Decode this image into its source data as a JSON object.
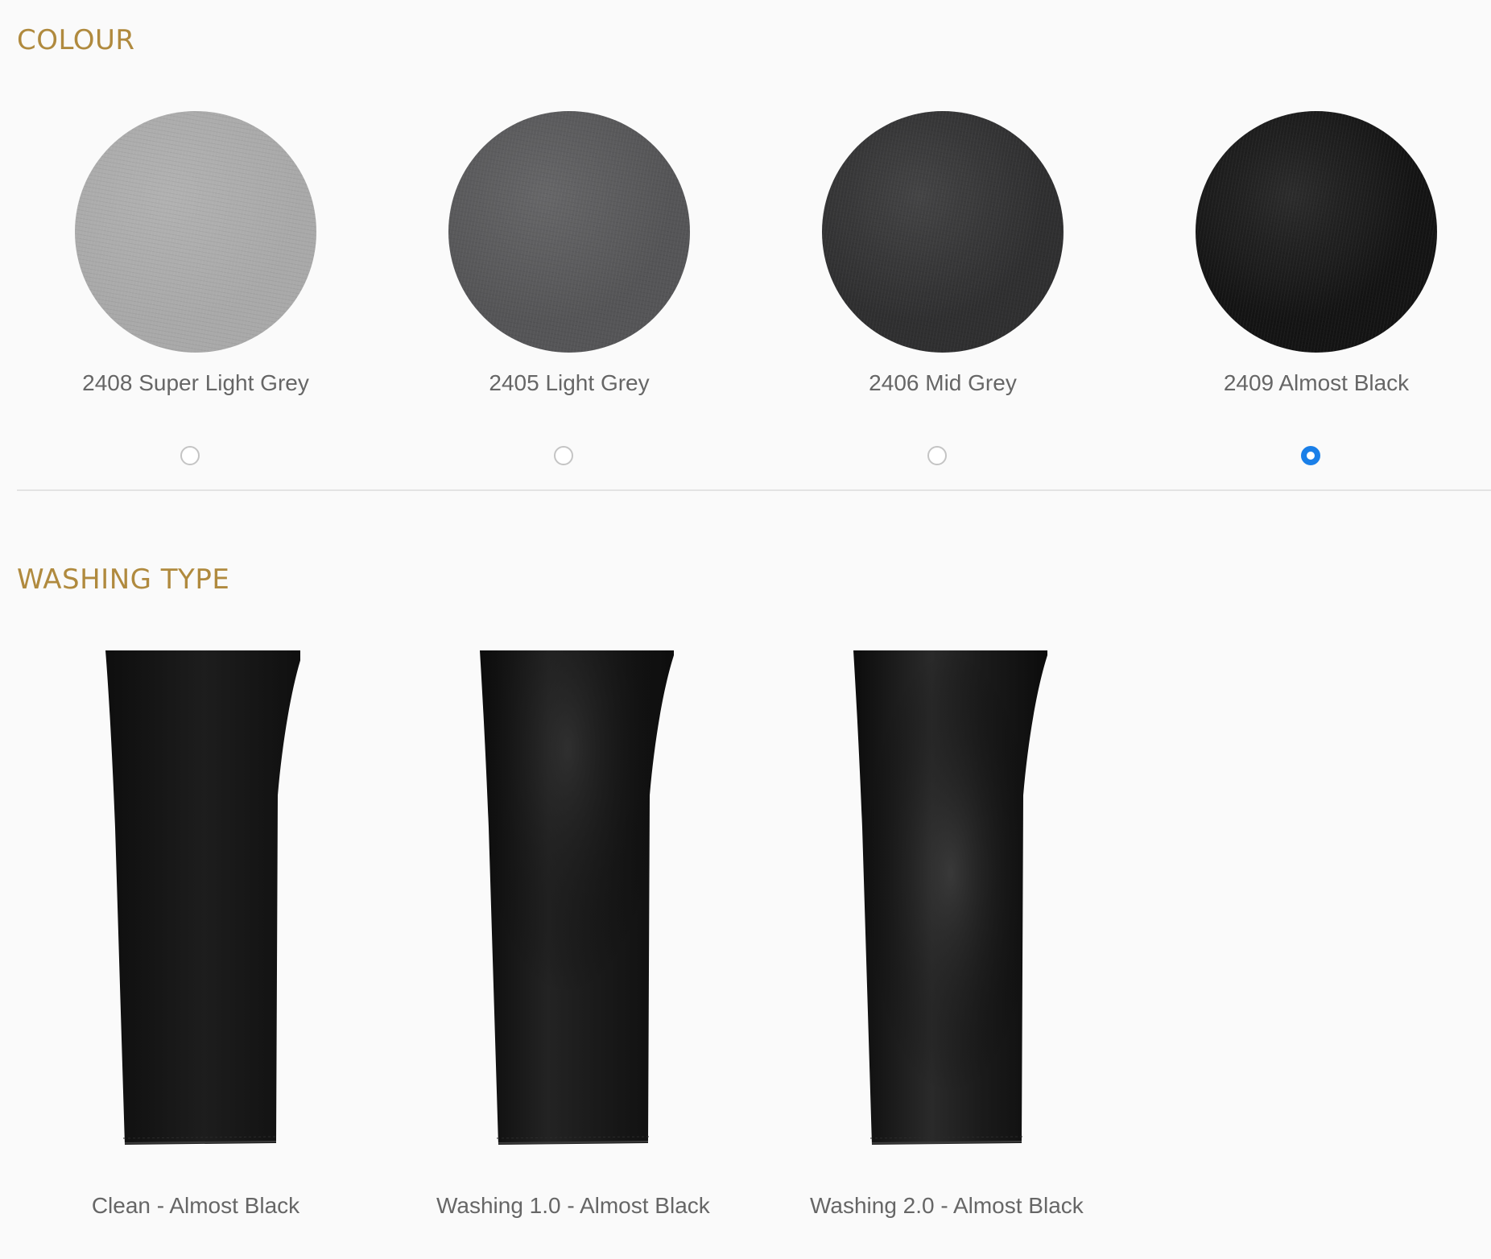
{
  "colour": {
    "title": "COLOUR",
    "selected_index": 3,
    "options": [
      {
        "label": "2408 Super Light Grey",
        "swatch_color": "#a9a9a9",
        "selected": false
      },
      {
        "label": "2405 Light Grey",
        "swatch_color": "#555557",
        "selected": false
      },
      {
        "label": "2406 Mid Grey",
        "swatch_color": "#2f2f30",
        "selected": false
      },
      {
        "label": "2409 Almost Black",
        "swatch_color": "#141414",
        "selected": true
      }
    ]
  },
  "washing": {
    "title": "WASHING TYPE",
    "options": [
      {
        "label": "Clean - Almost Black",
        "fabric_color": "#161616",
        "highlight_color": "#2a2a2a"
      },
      {
        "label": "Washing 1.0 - Almost Black",
        "fabric_color": "#141414",
        "highlight_color": "#3a3a3a"
      },
      {
        "label": "Washing 2.0 - Almost Black",
        "fabric_color": "#151515",
        "highlight_color": "#474747"
      }
    ]
  },
  "colors": {
    "section_title": "#b08a3e",
    "label_text": "#666666",
    "radio_selected": "#1a7fe8",
    "radio_border": "#c4c4c4",
    "divider": "#e3e3e3",
    "background": "#fafafa"
  }
}
